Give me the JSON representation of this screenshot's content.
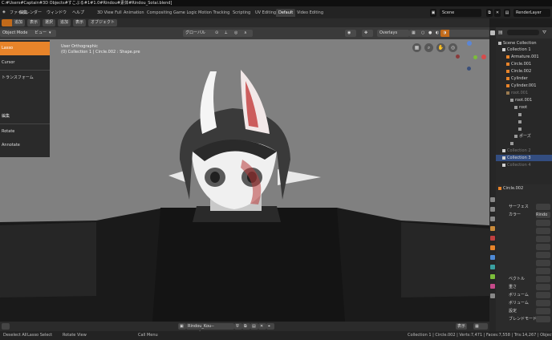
{
  "window": {
    "title": "C:#Users#Captain#3D Objects#すこぶる#1#1.0#Rindou#素体#Rindou_Sotai.blend]"
  },
  "menubar": {
    "menus": [
      "ファイル",
      "編集",
      "レンダー",
      "ウィンドウ",
      "ヘルプ"
    ],
    "workspace_tabs": [
      "3D View Full",
      "Animation",
      "Compositing",
      "Game Logic",
      "Motion Tracking",
      "Scripting",
      "UV Editing",
      "Default",
      "Video Editing"
    ],
    "active_tab": "Default",
    "scene_label": "Scene",
    "render_layer_label": "RenderLayer"
  },
  "toolstrip": {
    "buttons": [
      "",
      "追加",
      "表示",
      "選択",
      "追加",
      "表示",
      "オブジェクト"
    ]
  },
  "viewport_header": {
    "mode": "Object Mode",
    "view_menu": "ビュー",
    "transform_orientation": "グローバル",
    "overlays_label": "Overlays"
  },
  "viewport": {
    "view_name": "User Orthographic",
    "object_info": "(0) Collection 1 | Circle.002 : Shape.pre",
    "gizmo_axes": {
      "x": "X",
      "y": "Y",
      "z": "Z"
    }
  },
  "left_panel": {
    "items": [
      {
        "label": "Lasso",
        "selected": true
      },
      {
        "label": "Cursor",
        "selected": false
      },
      {
        "label": "トランスフォーム",
        "selected": false
      },
      {
        "label": "",
        "selected": false
      },
      {
        "label": "",
        "selected": false
      },
      {
        "label": "編集",
        "selected": false
      },
      {
        "label": "Rotate",
        "selected": false
      },
      {
        "label": "Annotate",
        "selected": false
      }
    ]
  },
  "image_bar": {
    "image_name": "Rindou_Kou-- parent.png",
    "view_label": "表示"
  },
  "statusbar": {
    "items": [
      "Deselect All",
      "Lasso Select",
      "Rotate View",
      "Call Menu"
    ],
    "stats": "Collection 1 | Circle.002 | Verts:7,471 | Faces:7,558 | Tris:14,267 | Objects:0/15 | Mem: 58.7 MiB"
  },
  "outliner": {
    "scene_collection": "Scene Collection",
    "rows": [
      {
        "label": "Collection 1",
        "indent": 1,
        "color": "#d0d0d0",
        "selected": false,
        "dim": false
      },
      {
        "label": "Armature.001",
        "indent": 2,
        "color": "#e8842a",
        "selected": false,
        "dim": false
      },
      {
        "label": "Circle.001",
        "indent": 2,
        "color": "#e8842a",
        "selected": false,
        "dim": false
      },
      {
        "label": "Circle.002",
        "indent": 2,
        "color": "#e8842a",
        "selected": false,
        "dim": false
      },
      {
        "label": "Cylinder",
        "indent": 2,
        "color": "#e8842a",
        "selected": false,
        "dim": false
      },
      {
        "label": "Cylinder.001",
        "indent": 2,
        "color": "#e8842a",
        "selected": false,
        "dim": false
      },
      {
        "label": "root.001",
        "indent": 2,
        "color": "#9a7a50",
        "selected": false,
        "dim": true
      },
      {
        "label": "root.001",
        "indent": 3,
        "color": "#9a9a9a",
        "selected": false,
        "dim": false
      },
      {
        "label": "root",
        "indent": 4,
        "color": "#9a9a9a",
        "selected": false,
        "dim": false
      },
      {
        "label": "",
        "indent": 5,
        "color": "#9a9a9a",
        "selected": false,
        "dim": false
      },
      {
        "label": "",
        "indent": 5,
        "color": "#9a9a9a",
        "selected": false,
        "dim": false
      },
      {
        "label": "",
        "indent": 5,
        "color": "#9a9a9a",
        "selected": false,
        "dim": false
      },
      {
        "label": "ポーズ",
        "indent": 4,
        "color": "#9a9a9a",
        "selected": false,
        "dim": false
      },
      {
        "label": "",
        "indent": 3,
        "color": "#9a9a9a",
        "selected": false,
        "dim": false
      },
      {
        "label": "Collection 2",
        "indent": 1,
        "color": "#d0d0d0",
        "selected": false,
        "dim": true
      },
      {
        "label": "Collection 3",
        "indent": 1,
        "color": "#d0d0d0",
        "selected": true,
        "dim": false
      },
      {
        "label": "Collection 4",
        "indent": 1,
        "color": "#d0d0d0",
        "selected": false,
        "dim": true
      }
    ]
  },
  "properties": {
    "object_name": "Circle.002",
    "rows": [
      "サーフェス",
      "カラー",
      "",
      "",
      "",
      "",
      "",
      "",
      "",
      "ベクトル",
      "重さ",
      "ボリューム",
      "ボリューム",
      "設定",
      "ブレンドモード"
    ],
    "color_value": "Rindo"
  },
  "colors": {
    "accent_orange": "#e8842a",
    "selection_blue": "#334d80",
    "viewport_gray": "#808080"
  }
}
